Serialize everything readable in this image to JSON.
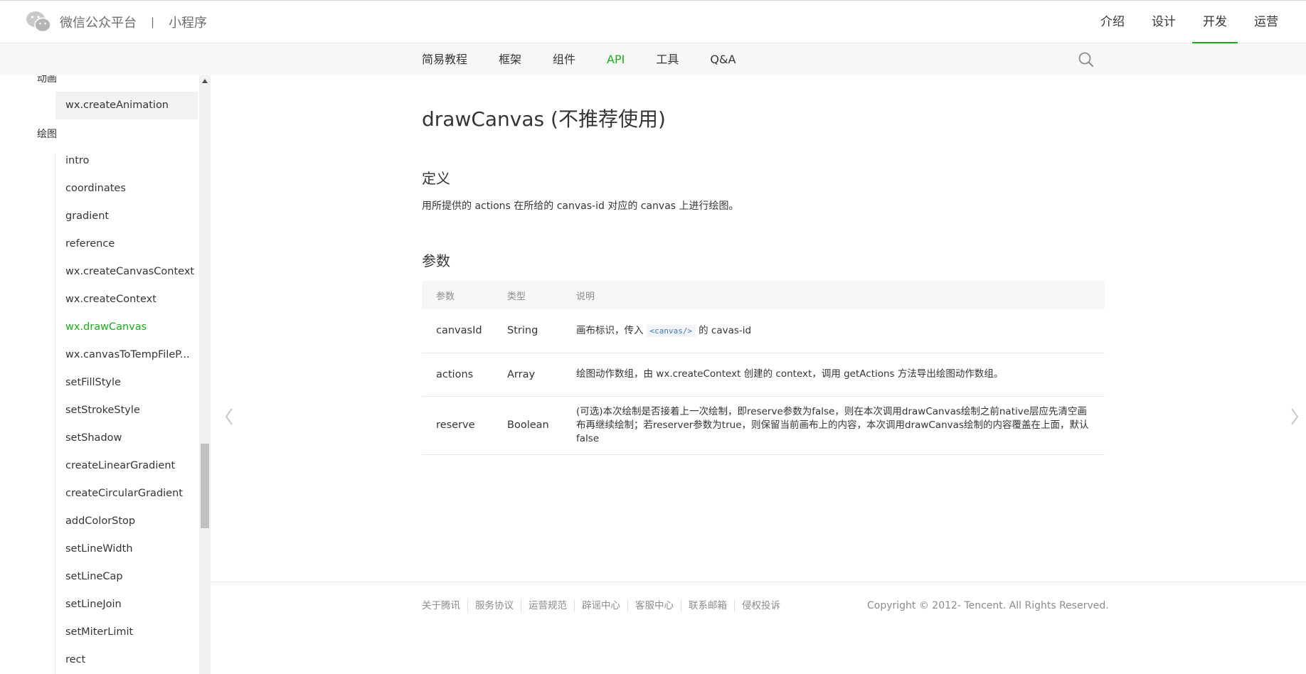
{
  "header": {
    "brand_name": "微信公众平台",
    "brand_sep": "|",
    "brand_sub": "小程序",
    "nav": [
      "介绍",
      "设计",
      "开发",
      "运营"
    ],
    "active_nav": "开发"
  },
  "subnav": {
    "items": [
      "简易教程",
      "框架",
      "组件",
      "API",
      "工具",
      "Q&A"
    ],
    "active": "API"
  },
  "sidebar": {
    "group_partial": "动画",
    "group_partial_item": "wx.createAnimation",
    "group_title": "绘图",
    "items": [
      "intro",
      "coordinates",
      "gradient",
      "reference",
      "wx.createCanvasContext",
      "wx.createContext",
      "wx.drawCanvas",
      "wx.canvasToTempFileP...",
      "setFillStyle",
      "setStrokeStyle",
      "setShadow",
      "createLinearGradient",
      "createCircularGradient",
      "addColorStop",
      "setLineWidth",
      "setLineCap",
      "setLineJoin",
      "setMiterLimit",
      "rect"
    ],
    "active_item": "wx.drawCanvas"
  },
  "content": {
    "title": "drawCanvas (不推荐使用)",
    "section_def": "定义",
    "def_before": "用所提供的 actions 在所给的 canvas-id 对应的 canvas 上进行绘图。",
    "section_params": "参数",
    "table": {
      "headers": [
        "参数",
        "类型",
        "说明"
      ],
      "rows": [
        {
          "name": "canvasId",
          "type": "String",
          "desc_before": "画布标识，传入",
          "desc_code": "<canvas/>",
          "desc_after": "的 cavas-id"
        },
        {
          "name": "actions",
          "type": "Array",
          "desc": "绘图动作数组，由 wx.createContext 创建的 context，调用 getActions 方法导出绘图动作数组。"
        },
        {
          "name": "reserve",
          "type": "Boolean",
          "desc": "(可选)本次绘制是否接着上一次绘制，即reserve参数为false，则在本次调用drawCanvas绘制之前native层应先清空画布再继续绘制；若reserver参数为true，则保留当前画布上的内容，本次调用drawCanvas绘制的内容覆盖在上面，默认 false"
        }
      ]
    }
  },
  "footer": {
    "links": [
      "关于腾讯",
      "服务协议",
      "运营规范",
      "辟谣中心",
      "客服中心",
      "联系邮箱",
      "侵权投诉"
    ],
    "copyright": "Copyright © 2012- Tencent. All Rights Reserved."
  },
  "colors": {
    "accent": "#1aad19",
    "code": "#3c7ac5"
  }
}
